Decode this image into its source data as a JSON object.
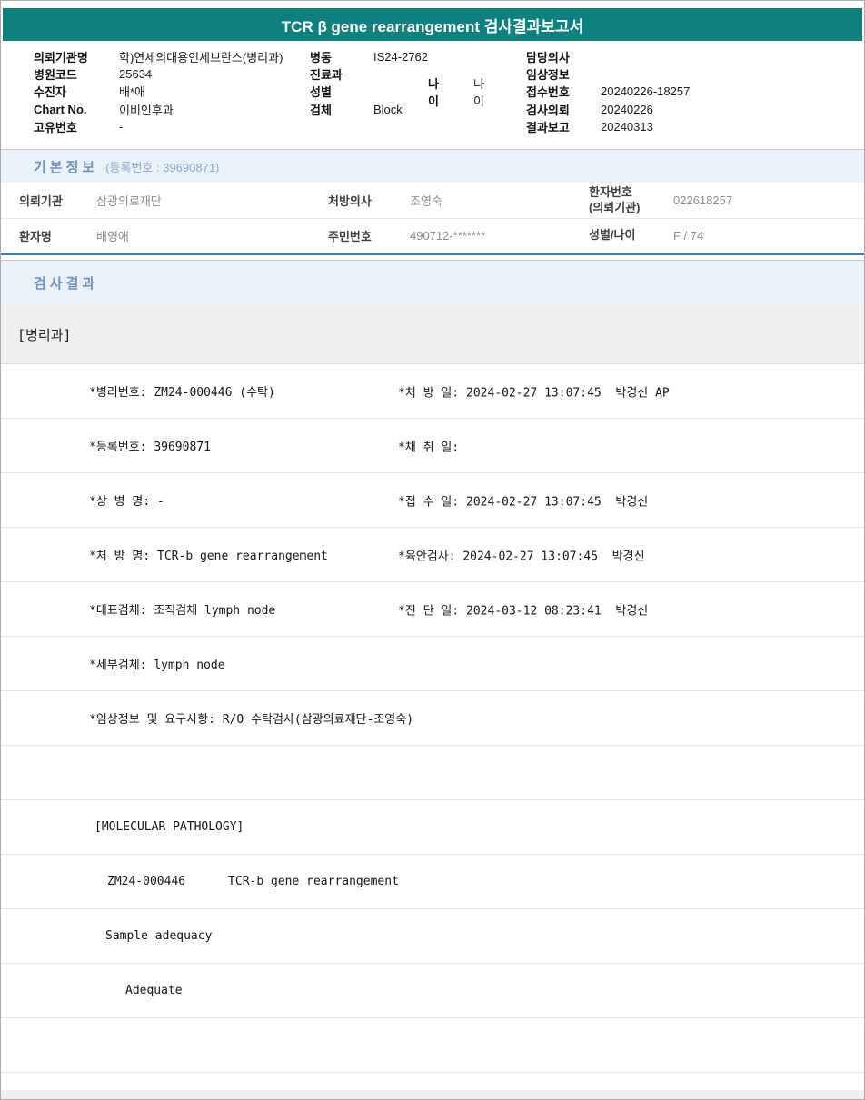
{
  "title": "TCR β gene rearrangement 검사결과보고서",
  "header_info": {
    "left": [
      {
        "label": "의뢰기관명",
        "value": "학)연세의대용인세브란스(병리과)"
      },
      {
        "label": "병원코드",
        "value": "25634"
      },
      {
        "label": "수진자",
        "value": "배*애"
      },
      {
        "label": "Chart No.",
        "value": "이비인후과"
      },
      {
        "label": "고유번호",
        "value": "-"
      }
    ],
    "middle": [
      {
        "label": "병동",
        "value": "IS24-2762"
      },
      {
        "label": "진료과",
        "value": ""
      },
      {
        "label": "성별",
        "value": "",
        "age_label": "나이",
        "age_value": "나이"
      },
      {
        "label": "검체",
        "value": "Block"
      }
    ],
    "right": [
      {
        "label": "담당의사",
        "value": ""
      },
      {
        "label": "임상정보",
        "value": ""
      },
      {
        "label": "접수번호",
        "value": "20240226-18257"
      },
      {
        "label": "검사의뢰",
        "value": "20240226"
      },
      {
        "label": "결과보고",
        "value": "20240313"
      }
    ]
  },
  "basic_info": {
    "section_title": "기본정보",
    "registration_note": "(등록번호 : 39690871)",
    "row1": {
      "c1_label": "의뢰기관",
      "c1_value": "삼광의료재단",
      "c2_label": "처방의사",
      "c2_value": "조영숙",
      "c3_label_line1": "환자번호",
      "c3_label_line2": "(의뢰기관)",
      "c3_value": "022618257"
    },
    "row2": {
      "c1_label": "환자명",
      "c1_value": "배영애",
      "c2_label": "주민번호",
      "c2_value": "490712-*******",
      "c3_label": "성별/나이",
      "c3_value": "F / 74"
    }
  },
  "results": {
    "section_title": "검사결과",
    "department": "[병리과]",
    "rows": [
      {
        "left": "*병리번호: ZM24-000446 (수탁)",
        "right": "*처 방 일: 2024-02-27 13:07:45  박경신 AP"
      },
      {
        "left": "*등록번호: 39690871",
        "right": "*채 취 일:"
      },
      {
        "left": "*상 병 명: -",
        "right": "*접 수 일: 2024-02-27 13:07:45  박경신"
      },
      {
        "left": "*처 방 명: TCR-b gene rearrangement",
        "right": "*육안검사: 2024-02-27 13:07:45  박경신"
      },
      {
        "left": "*대표검체: 조직검체 lymph node",
        "right": "*진 단 일: 2024-03-12 08:23:41  박경신"
      },
      {
        "left": "*세부검체: lymph node",
        "right": ""
      },
      {
        "left": "*임상정보 및 요구사항: R/O 수탁검사(삼광의료재단-조영숙)",
        "right": ""
      },
      {
        "left": "",
        "right": ""
      },
      {
        "left": "[MOLECULAR PATHOLOGY]",
        "right": ""
      },
      {
        "left": "ZM24-000446      TCR-b gene rearrangement",
        "right": ""
      },
      {
        "left": "Sample adequacy",
        "right": ""
      },
      {
        "left": "Adequate",
        "right": ""
      },
      {
        "left": "",
        "right": ""
      }
    ]
  }
}
